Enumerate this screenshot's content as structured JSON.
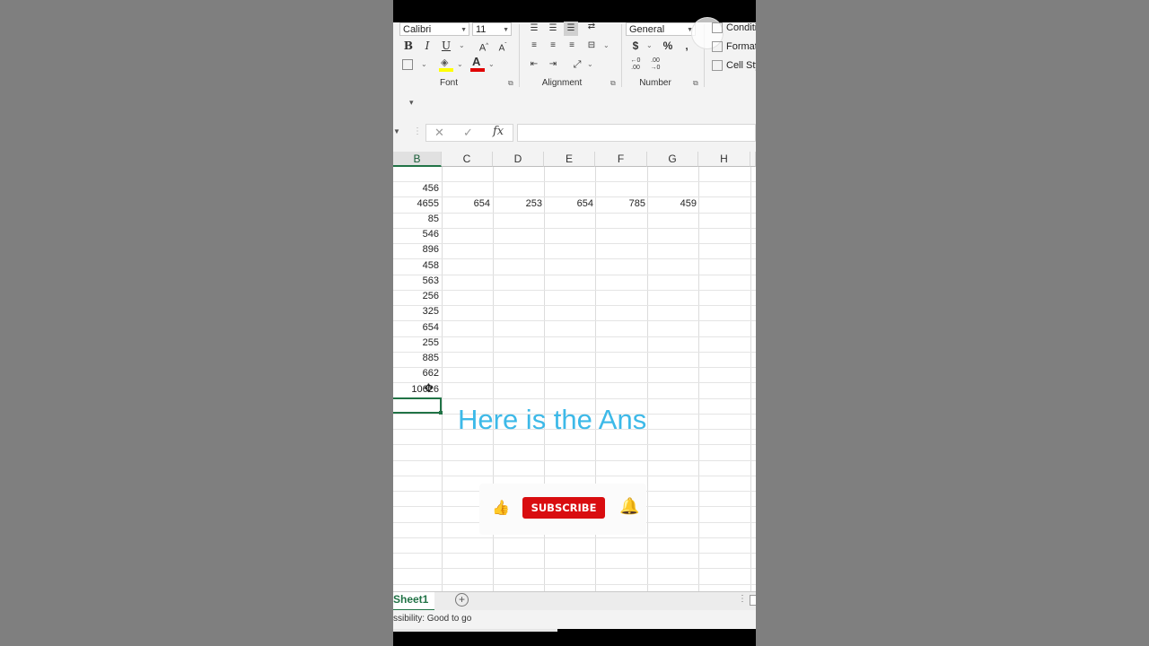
{
  "ribbon": {
    "font_name": "Calibri",
    "font_size": "11",
    "number_format": "General",
    "bold": "B",
    "italic": "I",
    "underline": "U",
    "dollar": "$",
    "percent": "%",
    "comma": ",",
    "groups": {
      "font": "Font",
      "alignment": "Alignment",
      "number": "Number"
    },
    "styles": [
      "Conditi",
      "Format",
      "Cell Sty"
    ]
  },
  "formula_bar": {
    "fx": "fx",
    "value": ""
  },
  "columns": [
    "B",
    "C",
    "D",
    "E",
    "F",
    "G",
    "H"
  ],
  "grid": {
    "column_b": [
      "456",
      "4655",
      "85",
      "546",
      "896",
      "458",
      "563",
      "256",
      "325",
      "654",
      "255",
      "885",
      "662",
      "10626"
    ],
    "row2_values": [
      "654",
      "253",
      "654",
      "785",
      "459"
    ]
  },
  "overlay": {
    "caption": "Here is the Ans",
    "subscribe_label": "SUBSCRIBE"
  },
  "sheet_tab": "Sheet1",
  "status_text": "ssibility: Good to go",
  "colors": {
    "excel_green": "#217346",
    "caption_blue": "#3db9e8",
    "subscribe_red": "#d90d10"
  }
}
